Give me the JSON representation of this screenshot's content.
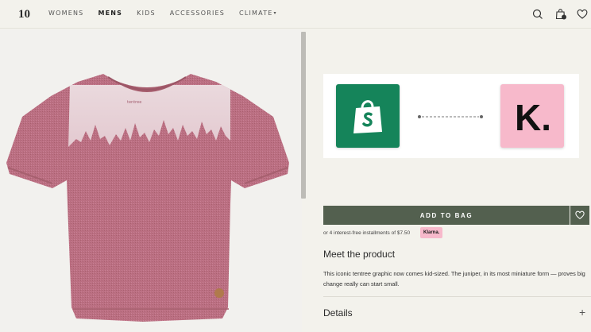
{
  "header": {
    "logo_text": "10",
    "nav": [
      {
        "label": "WOMENS",
        "active": false
      },
      {
        "label": "MENS",
        "active": true
      },
      {
        "label": "KIDS",
        "active": false
      },
      {
        "label": "ACCESSORIES",
        "active": false
      },
      {
        "label": "CLIMATE",
        "active": false
      }
    ],
    "cart_count": "0",
    "icons": [
      "search-icon",
      "bag-icon",
      "heart-icon"
    ]
  },
  "product": {
    "image_alt": "pink kids t-shirt with tree graphic",
    "tag_text": "tentree"
  },
  "integration": {
    "left_logo": "shopify",
    "right_logo_text": "K."
  },
  "purchase": {
    "add_to_bag_label": "ADD TO BAG",
    "installments_text": "or 4 interest-free installments of $7.50",
    "klarna_badge": "Klarna."
  },
  "info": {
    "meet_title": "Meet the product",
    "description": "This iconic tentree graphic now comes kid-sized. The juniper, in its most miniature form — proves big change really can start small.",
    "details_label": "Details",
    "details_toggle": "+"
  },
  "colors": {
    "background": "#f3f2ec",
    "button": "#53604f",
    "shopify_green": "#15845a",
    "klarna_pink": "#f7b9cb",
    "shirt": "#b86b7e"
  }
}
